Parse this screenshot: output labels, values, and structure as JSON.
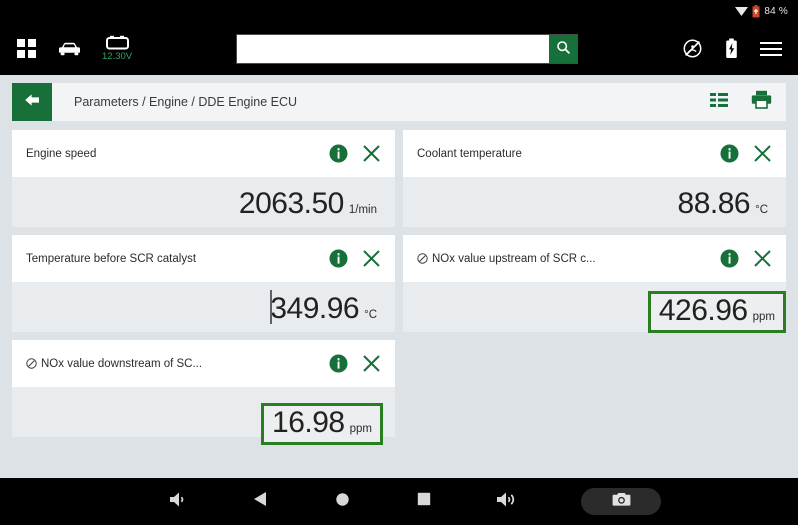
{
  "statusbar": {
    "wifi_icon": "wifi-triangle-icon",
    "battery_icon": "battery-icon",
    "battery_percent": "84 %"
  },
  "topbar": {
    "apps_icon": "apps-grid-icon",
    "vehicle_icon": "car-icon",
    "voltage_icon": "battery-voltage-icon",
    "voltage_label": "12.30V",
    "search": {
      "value": "",
      "placeholder": "",
      "button_icon": "search-icon"
    },
    "no_connection_icon": "no-connection-icon",
    "charging_icon": "battery-charging-icon",
    "menu_icon": "hamburger-menu-icon"
  },
  "breadcrumb": {
    "back_icon": "back-arrow-icon",
    "path": "Parameters / Engine / DDE Engine ECU",
    "list_view_icon": "list-view-icon",
    "print_icon": "printer-icon"
  },
  "colors": {
    "accent_green": "#17703a",
    "highlight_green": "#2a7d20",
    "voltage_green": "#2fa862",
    "page_bg": "#dde2e6",
    "card_head_bg": "#ffffff",
    "card_value_bg": "#e9ecee"
  },
  "cards": [
    {
      "title": "Engine speed",
      "prefix_icon": "",
      "value": "2063.50",
      "unit": "1/min",
      "highlighted": false,
      "info_icon": "info-icon",
      "close_icon": "close-icon"
    },
    {
      "title": "Coolant temperature",
      "prefix_icon": "",
      "value": "88.86",
      "unit": "°C",
      "highlighted": false,
      "info_icon": "info-icon",
      "close_icon": "close-icon"
    },
    {
      "title": "Temperature before SCR catalyst",
      "prefix_icon": "",
      "value": "349.96",
      "unit": "°C",
      "highlighted": false,
      "caret": true,
      "info_icon": "info-icon",
      "close_icon": "close-icon"
    },
    {
      "title": "NOx value upstream of SCR c...",
      "prefix_icon": "blocked-circle-icon",
      "value": "426.96",
      "unit": "ppm",
      "highlighted": true,
      "info_icon": "info-icon",
      "close_icon": "close-icon"
    },
    {
      "title": "NOx value downstream of SC...",
      "prefix_icon": "blocked-circle-icon",
      "value": "16.98",
      "unit": "ppm",
      "highlighted": true,
      "info_icon": "info-icon",
      "close_icon": "close-icon"
    }
  ],
  "navbar": {
    "buttons": [
      {
        "name": "volume-down-button",
        "icon": "volume-down-icon"
      },
      {
        "name": "back-button",
        "icon": "triangle-back-icon"
      },
      {
        "name": "home-button",
        "icon": "circle-home-icon"
      },
      {
        "name": "recents-button",
        "icon": "square-recents-icon"
      },
      {
        "name": "volume-up-button",
        "icon": "volume-up-icon"
      }
    ],
    "screenshot_button": {
      "name": "screenshot-button",
      "icon": "camera-icon"
    }
  }
}
